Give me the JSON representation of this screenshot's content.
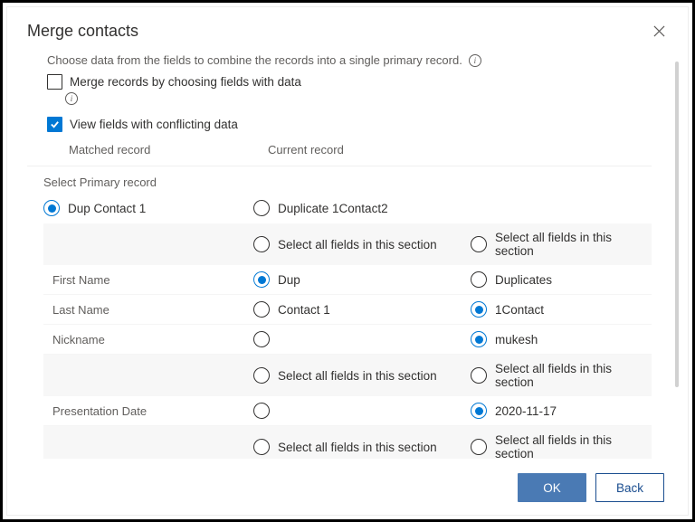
{
  "dialog": {
    "title": "Merge contacts",
    "description": "Choose data from the fields to combine the records into a single primary record.",
    "merge_by_fields_label": "Merge records by choosing fields with data",
    "view_conflicting_label": "View fields with conflicting data",
    "col_matched": "Matched record",
    "col_current": "Current record",
    "select_primary_label": "Select Primary record",
    "primary_options": {
      "left": "Dup Contact 1",
      "right": "Duplicate 1Contact2"
    },
    "select_all_label": "Select all fields in this section",
    "rows": [
      {
        "label": "First Name",
        "left": "Dup",
        "right": "Duplicates",
        "selected": "left"
      },
      {
        "label": "Last Name",
        "left": "Contact 1",
        "right": "1Contact",
        "selected": "right"
      },
      {
        "label": "Nickname",
        "left": "",
        "right": "mukesh",
        "selected": "right"
      }
    ],
    "rows2": [
      {
        "label": "Presentation Date",
        "left": "",
        "right": "2020-11-17",
        "selected": "right"
      }
    ],
    "buttons": {
      "ok": "OK",
      "back": "Back"
    }
  }
}
